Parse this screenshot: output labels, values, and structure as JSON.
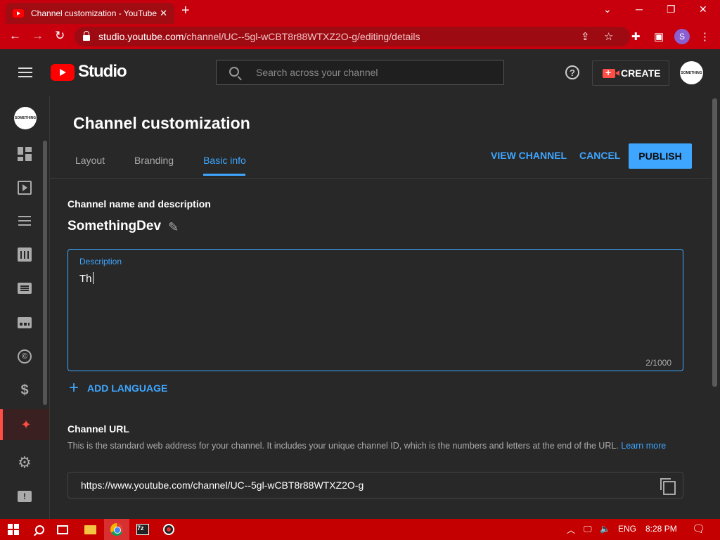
{
  "browser": {
    "tab_title": "Channel customization - YouTube Studio",
    "tab_close": "✕",
    "new_tab": "+",
    "window_controls": {
      "minimize": "─",
      "restore": "❐",
      "close": "✕",
      "dropdown": "⌄"
    },
    "url_host": "studio.youtube.com",
    "url_path": "/channel/UC--5gl-wCBT8r88WTXZ2O-g/editing/details",
    "profile_initial": "S",
    "icons": [
      "back-icon",
      "forward-icon",
      "reload-icon",
      "share-icon",
      "star-icon",
      "extensions-icon",
      "sidepanel-icon",
      "menu-icon"
    ]
  },
  "header": {
    "logo_text": "Studio",
    "search_placeholder": "Search across your channel",
    "help_glyph": "?",
    "create_label": "CREATE",
    "avatar_text": "SOMETHING"
  },
  "rail": {
    "avatar_text": "SOMETHING",
    "items": [
      {
        "name": "dashboard"
      },
      {
        "name": "content"
      },
      {
        "name": "playlists"
      },
      {
        "name": "analytics"
      },
      {
        "name": "comments"
      },
      {
        "name": "subtitles"
      },
      {
        "name": "copyright"
      },
      {
        "name": "earn"
      },
      {
        "name": "customization",
        "active": true
      },
      {
        "name": "settings"
      },
      {
        "name": "send-feedback"
      }
    ],
    "copyright_glyph": "©",
    "dollar_glyph": "$",
    "wand_glyph": "✦",
    "gear_glyph": "⚙",
    "feedback_glyph": "!"
  },
  "main": {
    "page_title": "Channel customization",
    "tabs": [
      {
        "label": "Layout",
        "active": false
      },
      {
        "label": "Branding",
        "active": false
      },
      {
        "label": "Basic info",
        "active": true
      }
    ],
    "view_channel_label": "VIEW CHANNEL",
    "cancel_label": "CANCEL",
    "publish_label": "PUBLISH",
    "name_section_title": "Channel name and description",
    "channel_name": "SomethingDev",
    "pencil_glyph": "✎",
    "description": {
      "label": "Description",
      "value": "Th",
      "counter": "2/1000"
    },
    "add_language": {
      "plus": "+",
      "label": "ADD LANGUAGE"
    },
    "channel_url": {
      "title": "Channel URL",
      "description": "This is the standard web address for your channel. It includes your unique channel ID, which is the numbers and letters at the end of the URL.",
      "learn_more": "Learn more",
      "value": "https://www.youtube.com/channel/UC--5gl-wCBT8r88WTXZ2O-g"
    }
  },
  "taskbar": {
    "language": "ENG",
    "time": "8:28 PM",
    "seven_zip": "7z",
    "tray_up": "︿",
    "tray_network": "🖵",
    "tray_volume": "🔈",
    "notification": "🗨"
  },
  "colors": {
    "browser_red": "#c8000e",
    "studio_bg": "#282828",
    "accent_blue": "#3ea6ff",
    "youtube_red": "#ff0000",
    "taskbar_red": "#c50000"
  }
}
